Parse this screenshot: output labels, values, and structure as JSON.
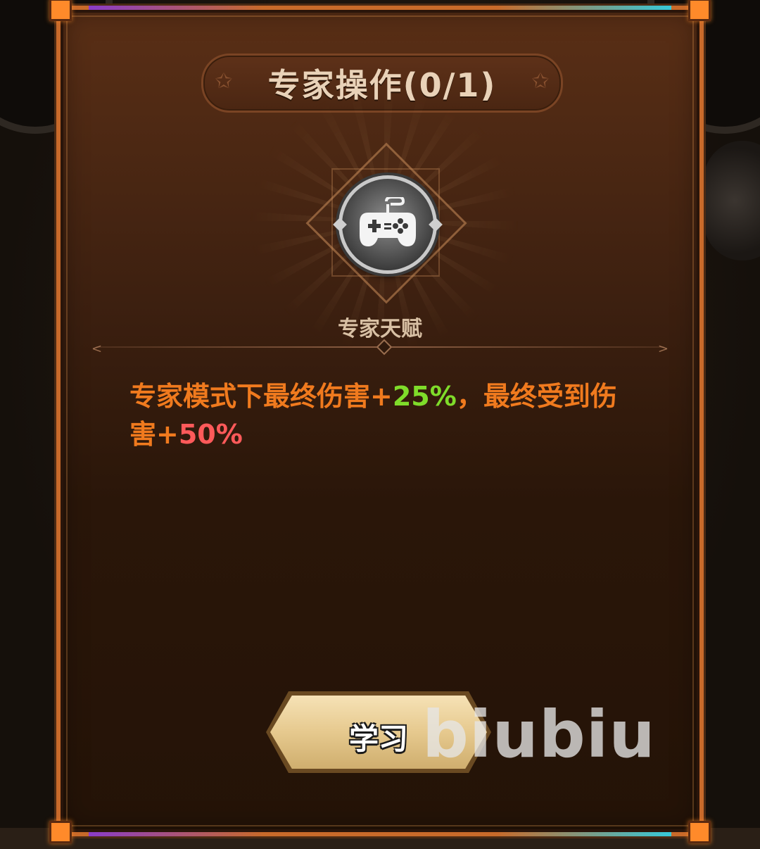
{
  "dialog": {
    "title": "专家操作(0/1)",
    "talent_icon": "gamepad-icon",
    "talent_name": "专家天赋",
    "description": {
      "part1": "专家模式下最终伤害+",
      "damage_bonus": "25%",
      "part2": "，最终受到伤害+",
      "damage_taken": "50%"
    },
    "learn_button_label": "学习"
  },
  "watermark": "biubiu",
  "colors": {
    "accent": "#f07a1e",
    "bonus": "#7fdc2a",
    "penalty": "#ff5a5a",
    "panel_border": "#c86a2a",
    "button_gold": "#e6c98e"
  }
}
